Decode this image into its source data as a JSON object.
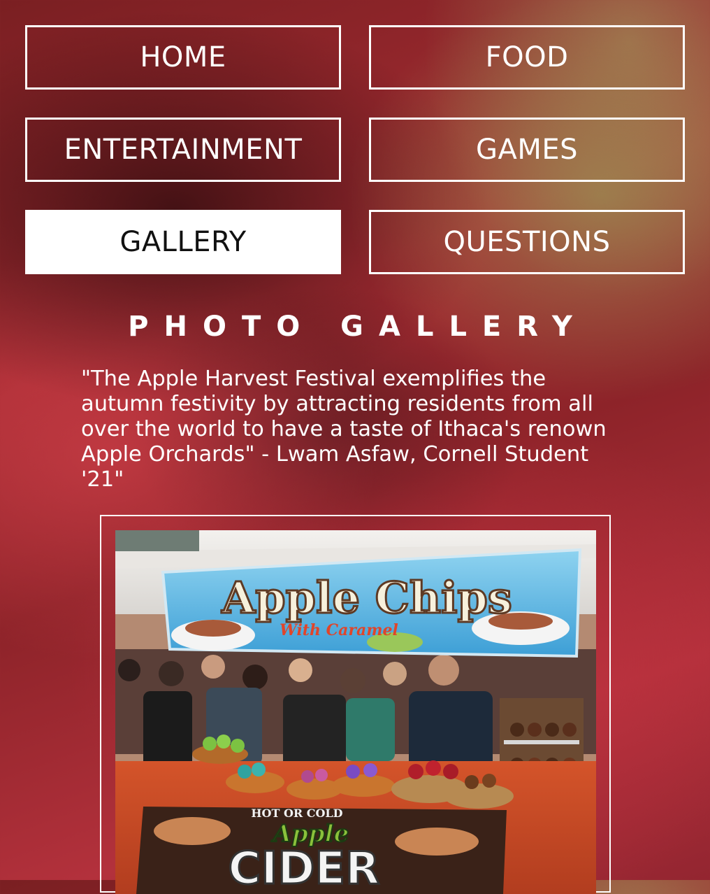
{
  "nav": {
    "items": [
      {
        "label": "HOME",
        "active": false
      },
      {
        "label": "FOOD",
        "active": false
      },
      {
        "label": "ENTERTAINMENT",
        "active": false
      },
      {
        "label": "GAMES",
        "active": false
      },
      {
        "label": "GALLERY",
        "active": true
      },
      {
        "label": "QUESTIONS",
        "active": false
      }
    ]
  },
  "gallery": {
    "title": "PHOTO GALLERY",
    "quote": "\"The Apple Harvest Festival exemplifies the autumn festivity by attracting residents from all over the world to have a taste of Ithaca's renown Apple Orchards\" - Lwam Asfaw, Cornell Student '21\"",
    "photo": {
      "banner_text": "Apple Chips",
      "banner_subtext": "With Caramel",
      "sign_small": "HOT OR COLD",
      "sign_apple": "Apple",
      "sign_main": "CIDER"
    }
  },
  "colors": {
    "background": "#9b2a31",
    "nav_border": "#ffffff",
    "active_bg": "#ffffff",
    "active_text": "#111111"
  }
}
